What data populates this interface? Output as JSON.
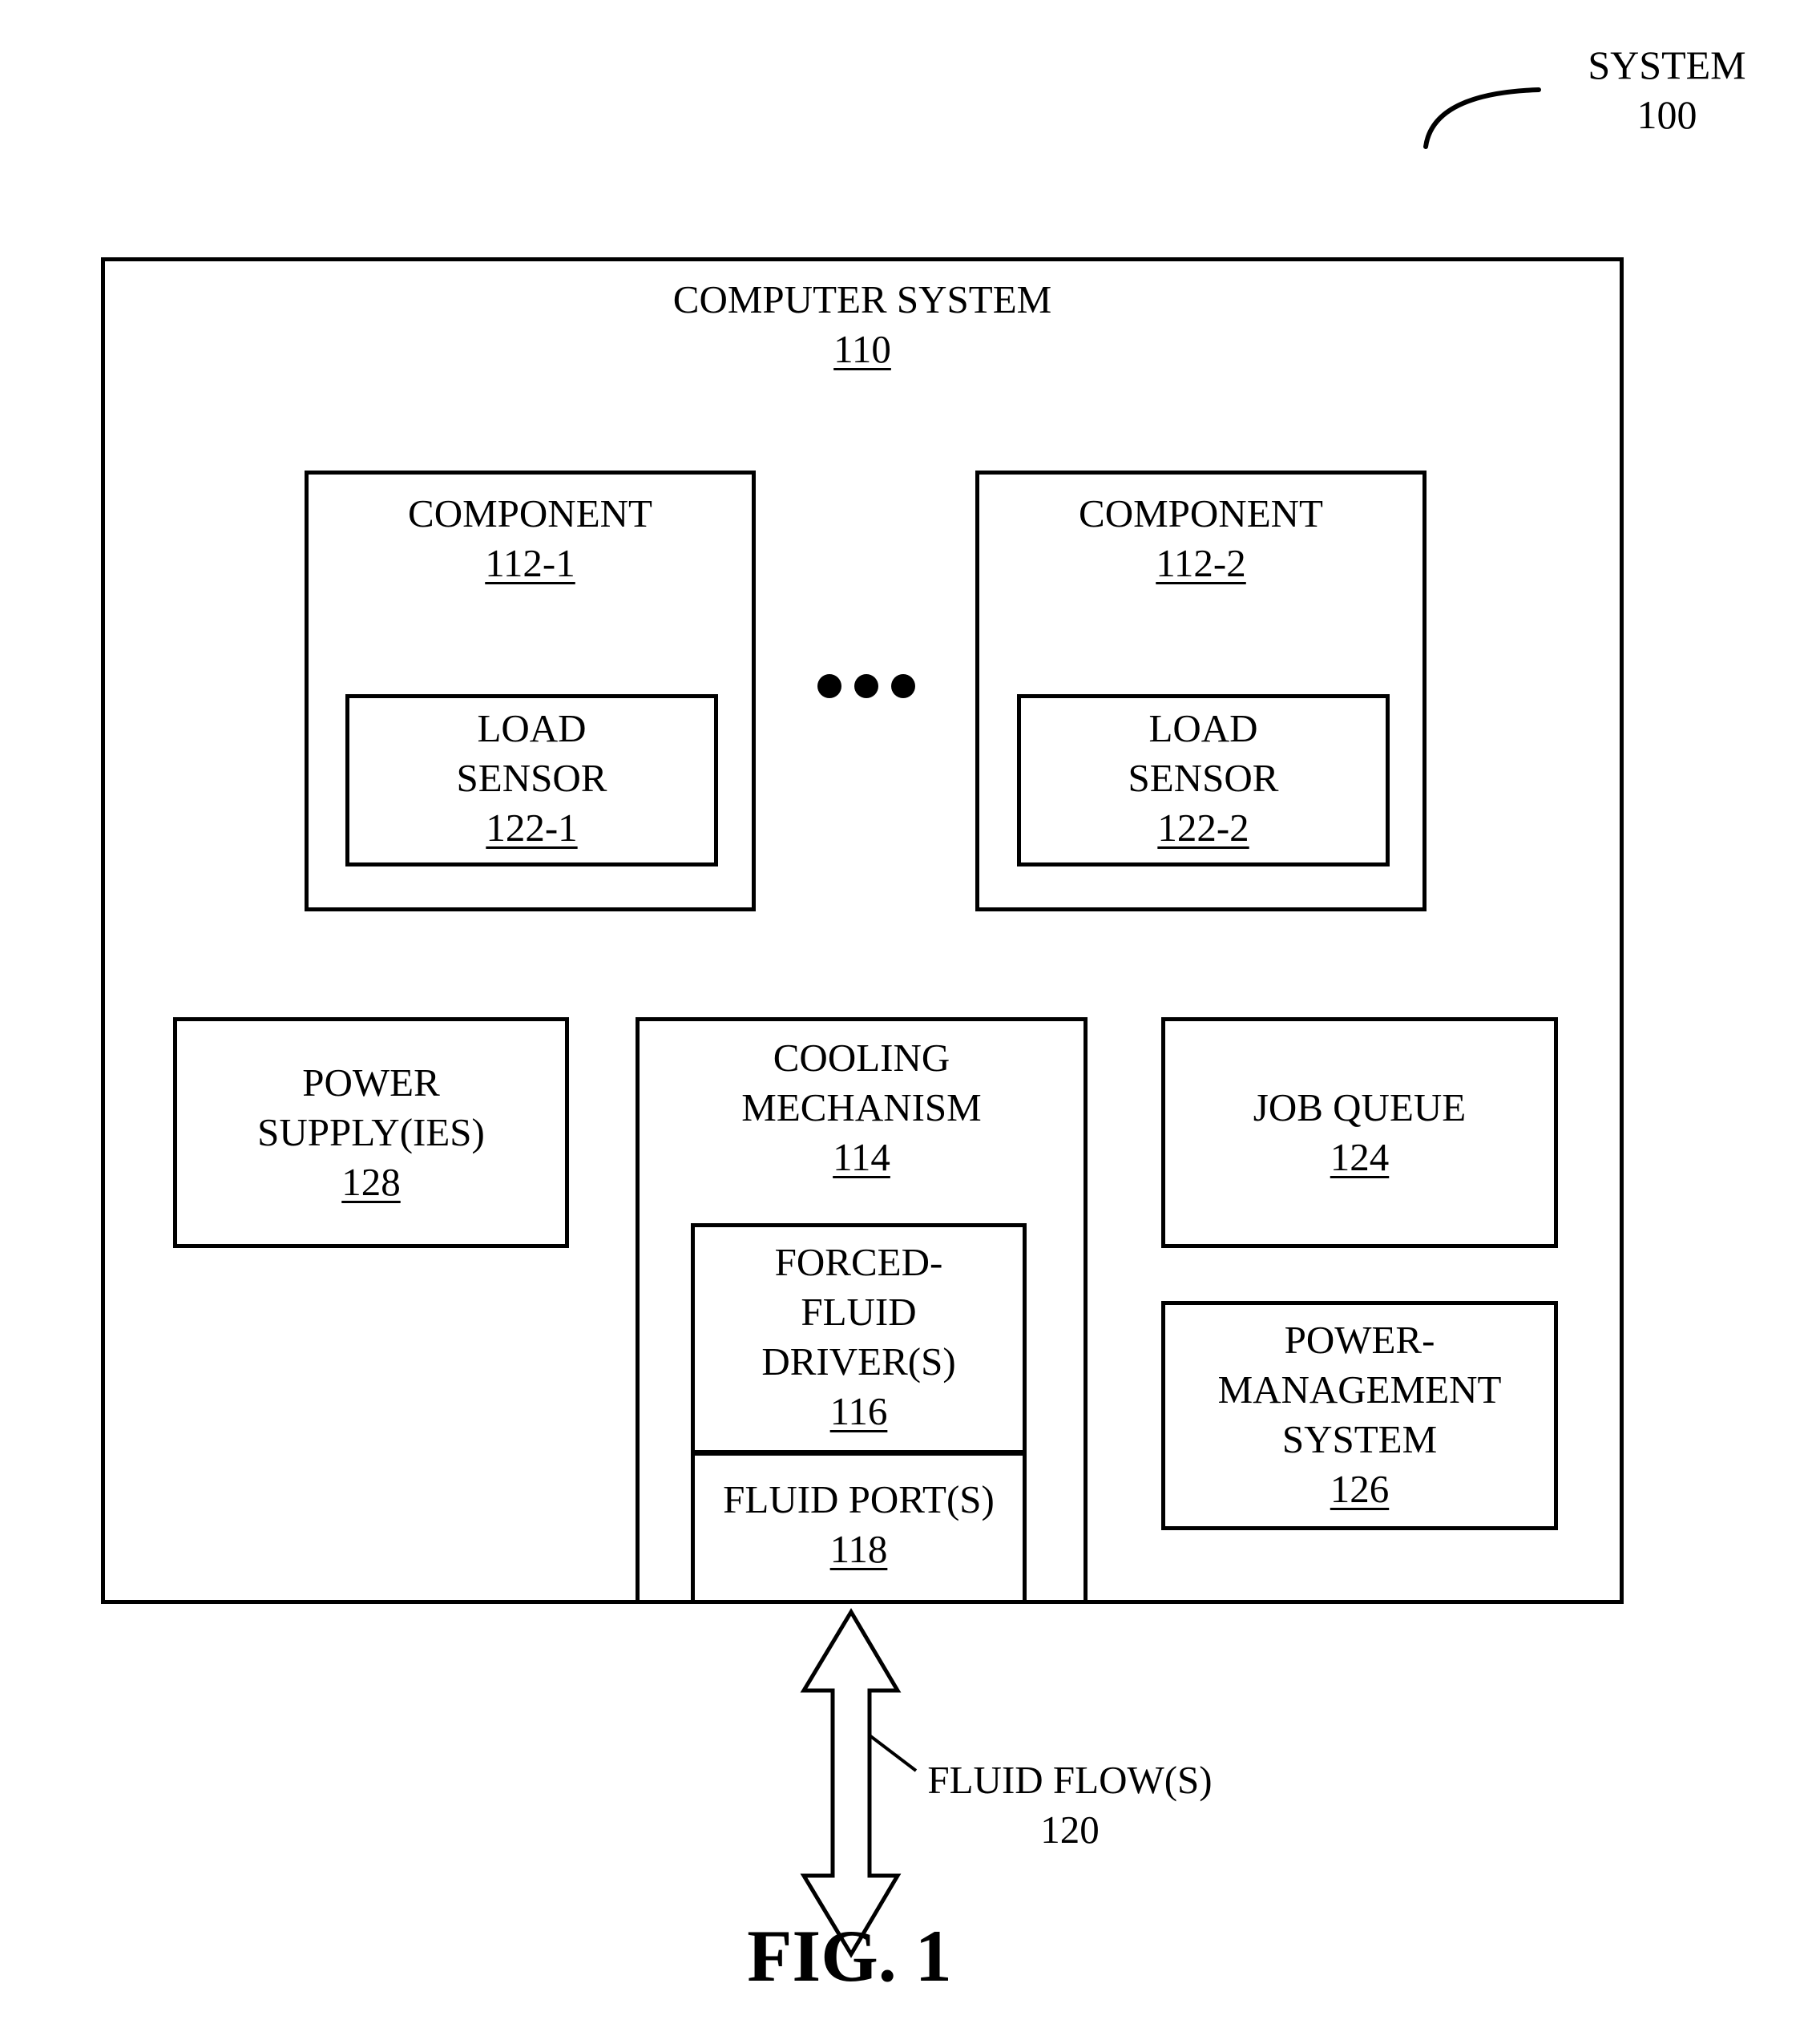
{
  "system": {
    "title": "SYSTEM",
    "ref": "100"
  },
  "computer_system": {
    "title": "COMPUTER SYSTEM",
    "ref": "110"
  },
  "components": [
    {
      "title": "COMPONENT",
      "ref": "112-1",
      "load_sensor": {
        "lines": [
          "LOAD",
          "SENSOR"
        ],
        "ref": "122-1"
      }
    },
    {
      "title": "COMPONENT",
      "ref": "112-2",
      "load_sensor": {
        "lines": [
          "LOAD",
          "SENSOR"
        ],
        "ref": "122-2"
      }
    }
  ],
  "ellipsis_icon": "ellipsis-dots",
  "power_supply": {
    "lines": [
      "POWER",
      "SUPPLY(IES)"
    ],
    "ref": "128"
  },
  "cooling_mechanism": {
    "lines": [
      "COOLING",
      "MECHANISM"
    ],
    "ref": "114",
    "forced_fluid_driver": {
      "lines": [
        "FORCED-",
        "FLUID",
        "DRIVER(S)"
      ],
      "ref": "116"
    },
    "fluid_port": {
      "lines": [
        "FLUID PORT(S)"
      ],
      "ref": "118"
    }
  },
  "job_queue": {
    "lines": [
      "JOB QUEUE"
    ],
    "ref": "124"
  },
  "power_management": {
    "lines": [
      "POWER-",
      "MANAGEMENT",
      "SYSTEM"
    ],
    "ref": "126"
  },
  "fluid_flow": {
    "title": "FLUID FLOW(S)",
    "ref": "120",
    "icon": "double-headed-arrow"
  },
  "figure_caption": "FIG. 1"
}
